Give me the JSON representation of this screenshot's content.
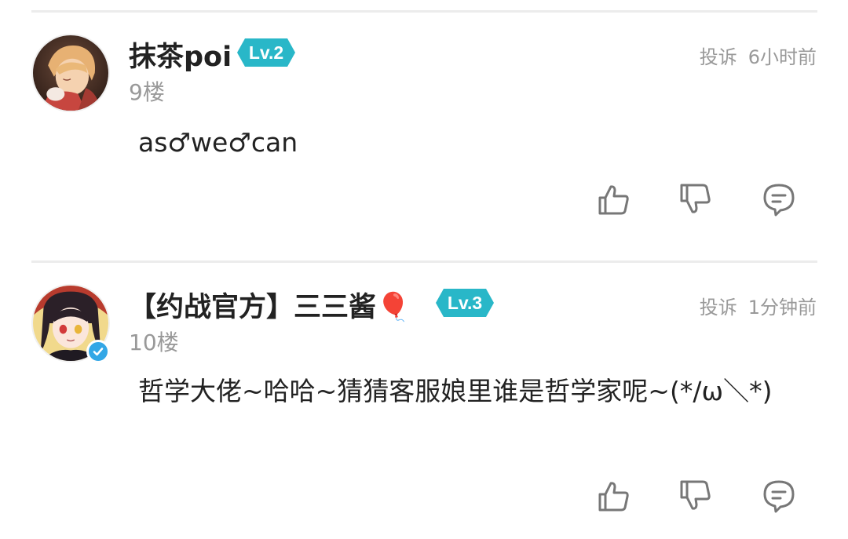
{
  "comments": [
    {
      "username": "抹茶poi",
      "level": "Lv.2",
      "floor": "9楼",
      "report_label": "投诉",
      "time": "6小时前",
      "content": "as♂we♂can",
      "verified": false
    },
    {
      "username": "【约战官方】三三酱🎈",
      "level": "Lv.3",
      "floor": "10楼",
      "report_label": "投诉",
      "time": "1分钟前",
      "content": "哲学大佬~哈哈~猜猜客服娘里谁是哲学家呢~(*/ω＼*)",
      "verified": true
    }
  ],
  "icons": {
    "like": "thumbs-up-icon",
    "dislike": "thumbs-down-icon",
    "reply": "comment-bubble-icon"
  },
  "colors": {
    "level_badge": "#29b7c8",
    "verified": "#33a7e6",
    "meta_text": "#999999"
  }
}
